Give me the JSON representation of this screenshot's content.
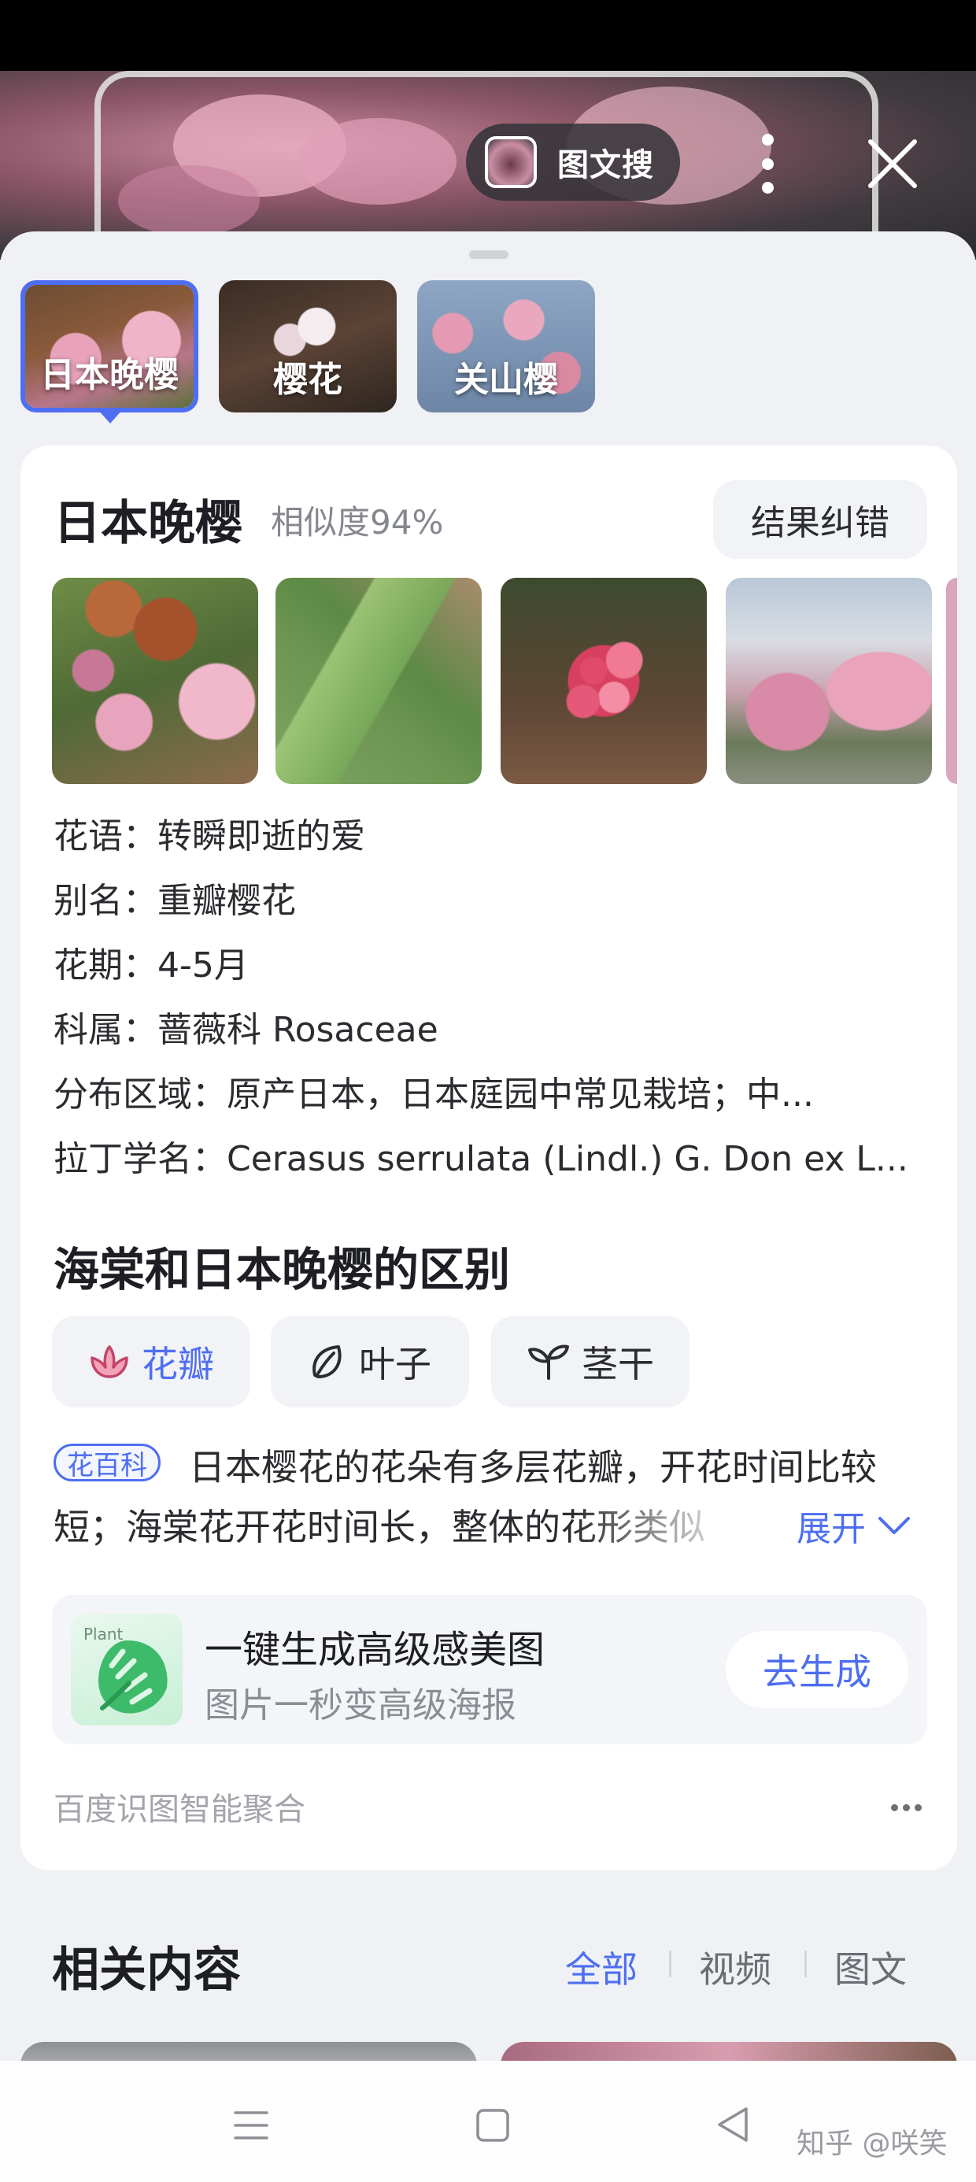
{
  "header": {
    "mode_label": "图文搜"
  },
  "candidates": [
    {
      "label": "日本晚樱",
      "selected": true
    },
    {
      "label": "樱花",
      "selected": false
    },
    {
      "label": "关山樱",
      "selected": false
    }
  ],
  "result": {
    "title": "日本晚樱",
    "similarity": "相似度94%",
    "correct_button": "结果纠错",
    "facts": [
      {
        "key": "花语：",
        "value": "转瞬即逝的爱"
      },
      {
        "key": "别名：",
        "value": "重瓣樱花"
      },
      {
        "key": "花期：",
        "value": "4-5月"
      },
      {
        "key": "科属：",
        "value": "蔷薇科 Rosaceae"
      },
      {
        "key": "分布区域：",
        "value": "原产日本，日本庭园中常见栽培；中..."
      },
      {
        "key": "拉丁学名：",
        "value": "Cerasus serrulata (Lindl.) G. Don ex L..."
      }
    ]
  },
  "difference": {
    "title": "海棠和日本晚樱的区别",
    "chips": [
      {
        "label": "花瓣",
        "icon": "flower-icon",
        "active": true
      },
      {
        "label": "叶子",
        "icon": "leaf-icon",
        "active": false
      },
      {
        "label": "茎干",
        "icon": "sprout-icon",
        "active": false
      }
    ],
    "badge": "花百科",
    "description_line1": "日本樱花的花朵有多层花瓣，开花时间比较",
    "description_line2": "短；海棠花开花时间长，整体的花形类似",
    "expand_label": "展开"
  },
  "promo": {
    "icon_text": "Plant",
    "title": "一键生成高级感美图",
    "subtitle": "图片一秒变高级海报",
    "button": "去生成"
  },
  "card_footer": "百度识图智能聚合",
  "related": {
    "title": "相关内容",
    "tabs": [
      {
        "label": "全部",
        "active": true
      },
      {
        "label": "视频",
        "active": false
      },
      {
        "label": "图文",
        "active": false
      }
    ]
  },
  "watermark": "知乎 @咲笑",
  "colors": {
    "accent": "#4e6ef2",
    "page_bg": "#f0f1f4",
    "card_bg": "#ffffff"
  }
}
